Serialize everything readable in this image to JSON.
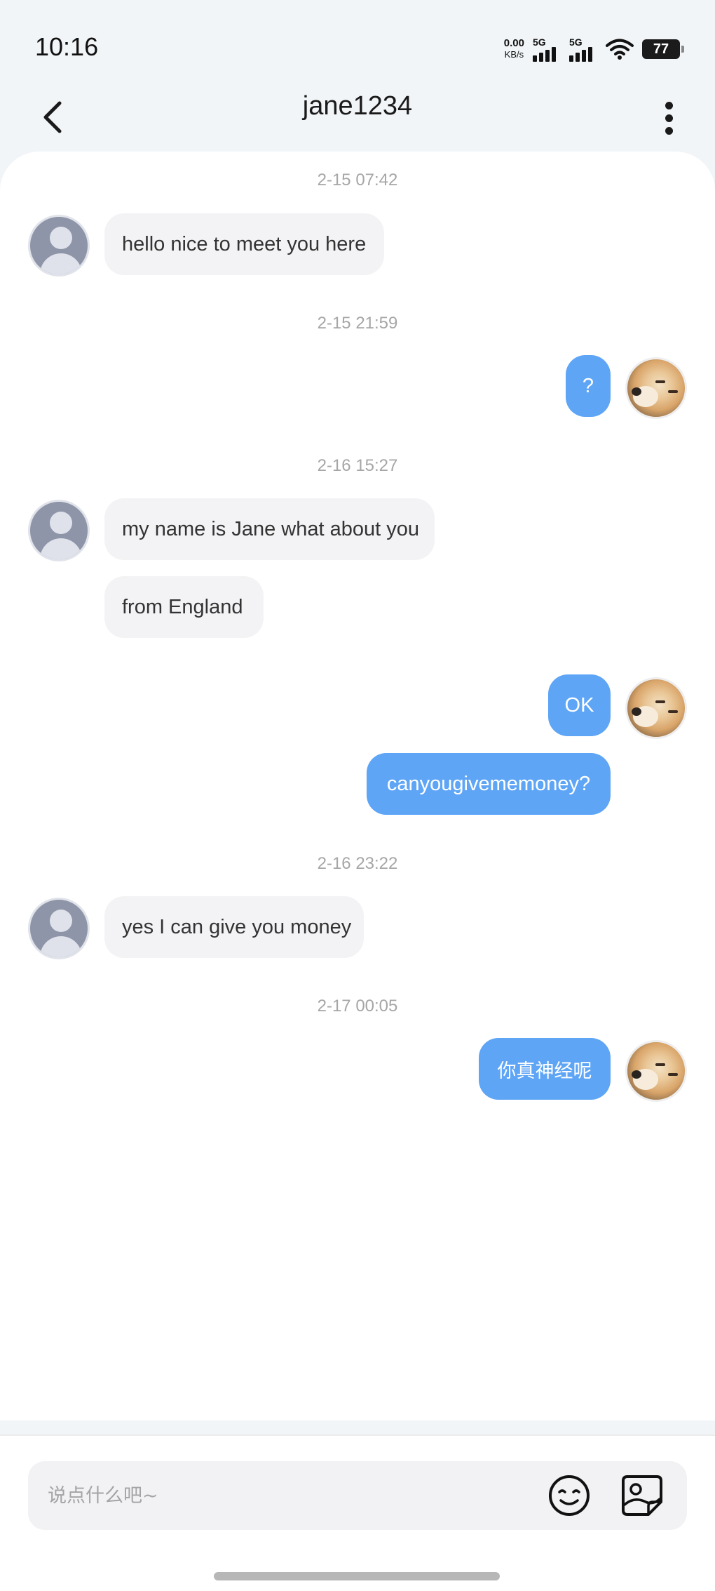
{
  "status_bar": {
    "time": "10:16",
    "net_speed_value": "0.00",
    "net_speed_unit": "KB/s",
    "sim1_label": "5G",
    "sim2_label": "5G",
    "battery_level": "77",
    "icons": [
      "signal-icon",
      "signal-icon",
      "wifi-icon",
      "battery-icon"
    ]
  },
  "header": {
    "title": "jane1234",
    "back_icon": "chevron-left-icon",
    "more_icon": "more-vertical-icon"
  },
  "messages": {
    "ts1": "2-15 07:42",
    "m1": "hello nice to meet you here",
    "ts2": "2-15 21:59",
    "m2": "?",
    "ts3": "2-16 15:27",
    "m3": "my name is Jane what about you",
    "m4": "from England",
    "m5": "OK",
    "m6": "canyougivememoney?",
    "ts4": "2-16 23:22",
    "m7": "yes I can give you money",
    "ts5": "2-17 00:05",
    "m8": "你真神经呢"
  },
  "composer": {
    "placeholder": "说点什么吧~",
    "emoji_icon": "smiley-icon",
    "sticker_icon": "sticker-icon"
  },
  "colors": {
    "outgoing_bubble": "#5ea5f6",
    "incoming_bubble": "#f3f3f5",
    "background": "#f2f5f8"
  }
}
